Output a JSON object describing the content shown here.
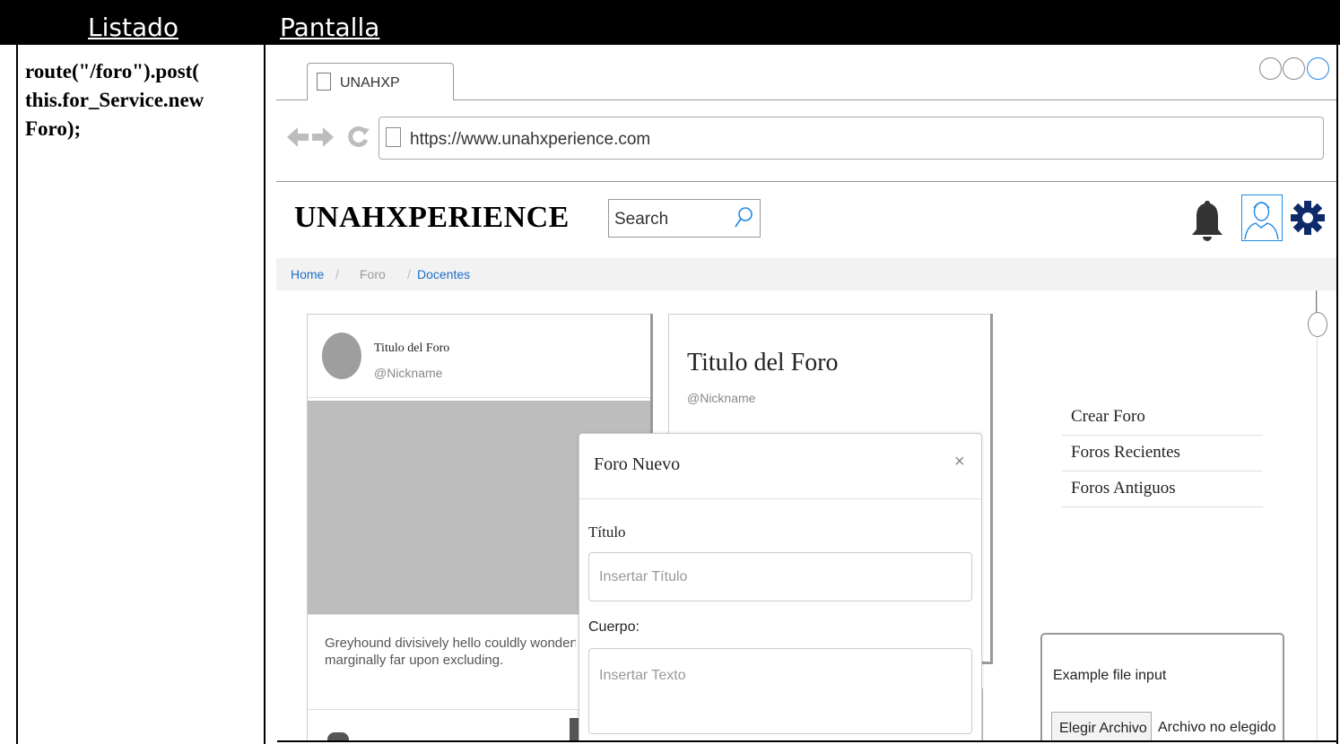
{
  "table": {
    "col_listado": "Listado",
    "col_pantalla": "Pantalla",
    "code_line1": "route(\"/foro\").post(",
    "code_line2": "this.for_Service.new",
    "code_line3": "Foro);"
  },
  "browser": {
    "tab_label": "UNAHXP",
    "url": "https://www.unahxperience.com"
  },
  "site": {
    "brand": "UNAHXPERIENCE",
    "search_placeholder": "Search",
    "accent": "#1e88e5",
    "gear_color": "#0d2a6b"
  },
  "breadcrumb": {
    "home": "Home",
    "sep": "/",
    "foro": "Foro",
    "docentes": "Docentes"
  },
  "card1": {
    "title": "Titulo del Foro",
    "nickname": "@Nickname",
    "text_line1": "Greyhound divisively hello couldly wonderfu",
    "text_line2": "marginally far upon excluding."
  },
  "card2": {
    "title": "Titulo del Foro",
    "nickname": "@Nickname"
  },
  "modal": {
    "title": "Foro Nuevo",
    "close": "×",
    "label_titulo": "Título",
    "placeholder_titulo": "Insertar Título",
    "label_cuerpo": "Cuerpo:",
    "placeholder_cuerpo": "Insertar Texto"
  },
  "menu": {
    "items": [
      "Crear Foro",
      "Foros Recientes",
      "Foros Antiguos"
    ]
  },
  "file_input": {
    "label": "Example file input",
    "button": "Elegir Archivo",
    "status": "Archivo no elegido"
  }
}
